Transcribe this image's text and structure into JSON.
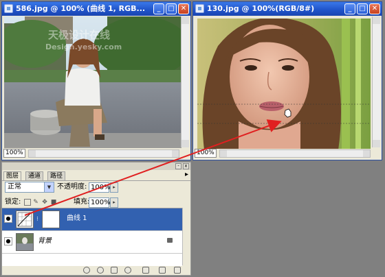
{
  "windows": {
    "left": {
      "title": "586.jpg @ 100% (曲线 1, RGB...",
      "zoom": "100%",
      "watermark": "天极设计在线",
      "watermark_url": "Design.yesky.com"
    },
    "right": {
      "title": "130.jpg @ 100%(RGB/8#)",
      "zoom": "100%"
    }
  },
  "layers_panel": {
    "tabs": [
      {
        "label": "图层"
      },
      {
        "label": "通道"
      },
      {
        "label": "路径"
      }
    ],
    "blend_mode": "正常",
    "opacity_label": "不透明度:",
    "opacity_value": "100%",
    "lock_label": "锁定:",
    "fill_label": "填充:",
    "fill_value": "100%",
    "layers": [
      {
        "name": "曲线 1",
        "selected": true
      },
      {
        "name": "背景",
        "selected": false,
        "locked": true
      }
    ],
    "bottom_icons": [
      "link-icon",
      "fx-icon",
      "mask-icon",
      "adjustment-icon",
      "folder-icon",
      "new-layer-icon",
      "trash-icon"
    ]
  },
  "colors": {
    "titlebar": "#1f52c8",
    "selected_layer": "#3261b0",
    "arrow": "#e02020",
    "workspace": "#808080"
  }
}
